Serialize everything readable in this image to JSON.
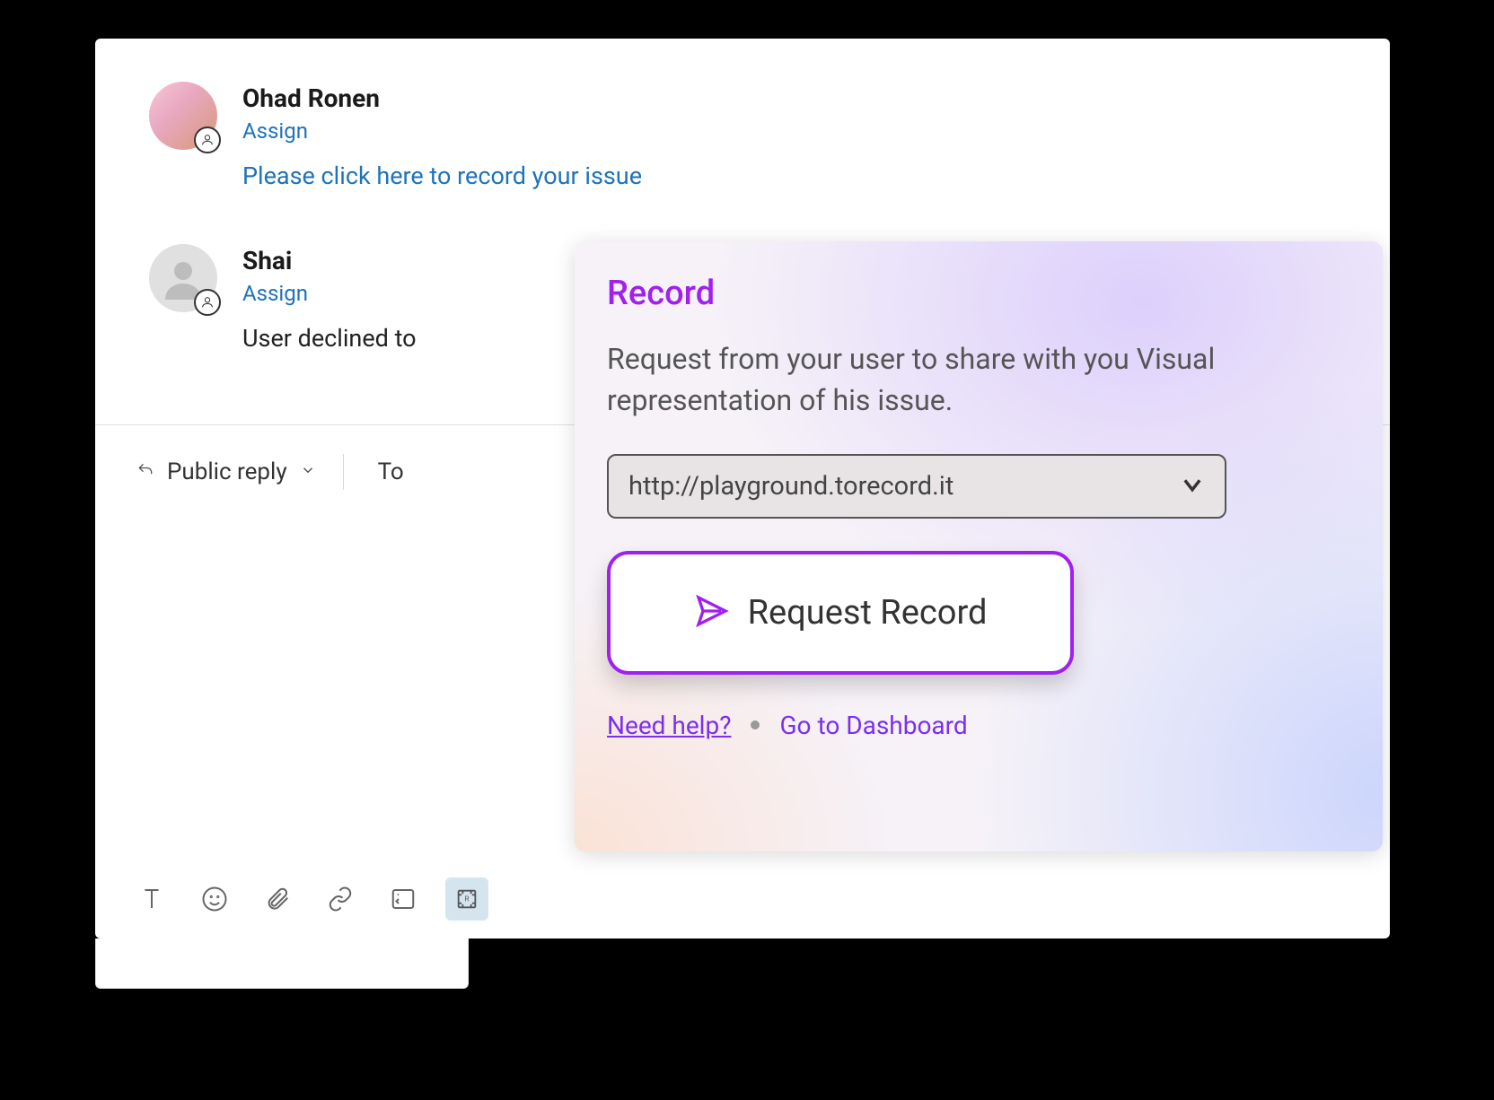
{
  "messages": [
    {
      "name": "Ohad Ronen",
      "assign_label": "Assign",
      "body": "Please click here to record your issue",
      "has_photo": true
    },
    {
      "name": "Shai",
      "assign_label": "Assign",
      "body": "User declined to",
      "has_photo": false
    }
  ],
  "reply": {
    "type_label": "Public reply",
    "to_label": "To"
  },
  "popover": {
    "title": "Record",
    "description": "Request from your user to share with you Visual representation of his issue.",
    "url": "http://playground.torecord.it",
    "button_label": "Request Record",
    "help_label": "Need help?",
    "dashboard_label": "Go to Dashboard"
  },
  "colors": {
    "accent_purple": "#a020f0",
    "link_blue": "#1f73b7",
    "footer_purple": "#7b2ff0"
  },
  "icons": {
    "reply": "reply-arrow-icon",
    "chevron": "chevron-down-icon",
    "text": "text-format-icon",
    "emoji": "emoji-icon",
    "attach": "paperclip-icon",
    "link": "link-icon",
    "code": "code-block-icon",
    "record": "record-expand-icon",
    "send": "send-icon"
  }
}
